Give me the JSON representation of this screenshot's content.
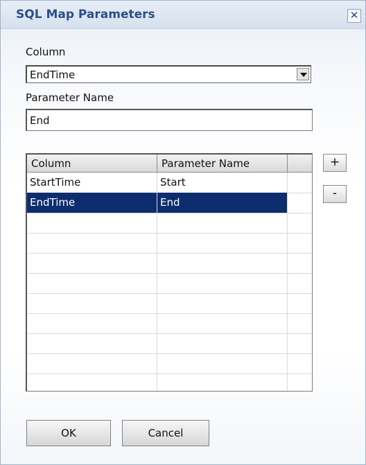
{
  "window": {
    "title": "SQL Map Parameters",
    "close_glyph": "✕"
  },
  "form": {
    "column_label": "Column",
    "column_value": "EndTime",
    "param_label": "Parameter Name",
    "param_value": "End"
  },
  "grid": {
    "headers": [
      "Column",
      "Parameter Name"
    ],
    "rows": [
      {
        "column": "StartTime",
        "param": "Start",
        "selected": false
      },
      {
        "column": "EndTime",
        "param": "End",
        "selected": true
      }
    ],
    "selection_color": "#0d2d6e"
  },
  "buttons": {
    "add": "+",
    "remove": "-",
    "ok": "OK",
    "cancel": "Cancel"
  }
}
